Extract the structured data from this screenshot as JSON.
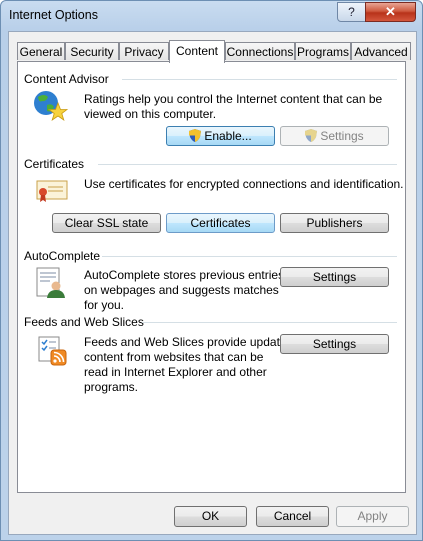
{
  "window": {
    "title": "Internet Options",
    "help_glyph": "?",
    "close_glyph": "✕"
  },
  "tabs": [
    {
      "label": "General"
    },
    {
      "label": "Security"
    },
    {
      "label": "Privacy"
    },
    {
      "label": "Content",
      "active": true
    },
    {
      "label": "Connections"
    },
    {
      "label": "Programs"
    },
    {
      "label": "Advanced"
    }
  ],
  "content_advisor": {
    "title": "Content Advisor",
    "description_line1": "Ratings help you control the Internet content that can be",
    "description_line2": "viewed on this computer.",
    "enable_label": "Enable...",
    "settings_label": "Settings"
  },
  "certificates": {
    "title": "Certificates",
    "description": "Use certificates for encrypted connections and identification.",
    "clear_ssl_label": "Clear SSL state",
    "certificates_label": "Certificates",
    "publishers_label": "Publishers"
  },
  "autocomplete": {
    "title": "AutoComplete",
    "description_line1": "AutoComplete stores previous entries",
    "description_line2": "on webpages and suggests matches",
    "description_line3": "for you.",
    "settings_label": "Settings"
  },
  "feeds": {
    "title": "Feeds and Web Slices",
    "description_line1": "Feeds and Web Slices provide updated",
    "description_line2": "content from websites that can be",
    "description_line3": "read in Internet Explorer and other",
    "description_line4": "programs.",
    "settings_label": "Settings"
  },
  "footer": {
    "ok_label": "OK",
    "cancel_label": "Cancel",
    "apply_label": "Apply"
  }
}
